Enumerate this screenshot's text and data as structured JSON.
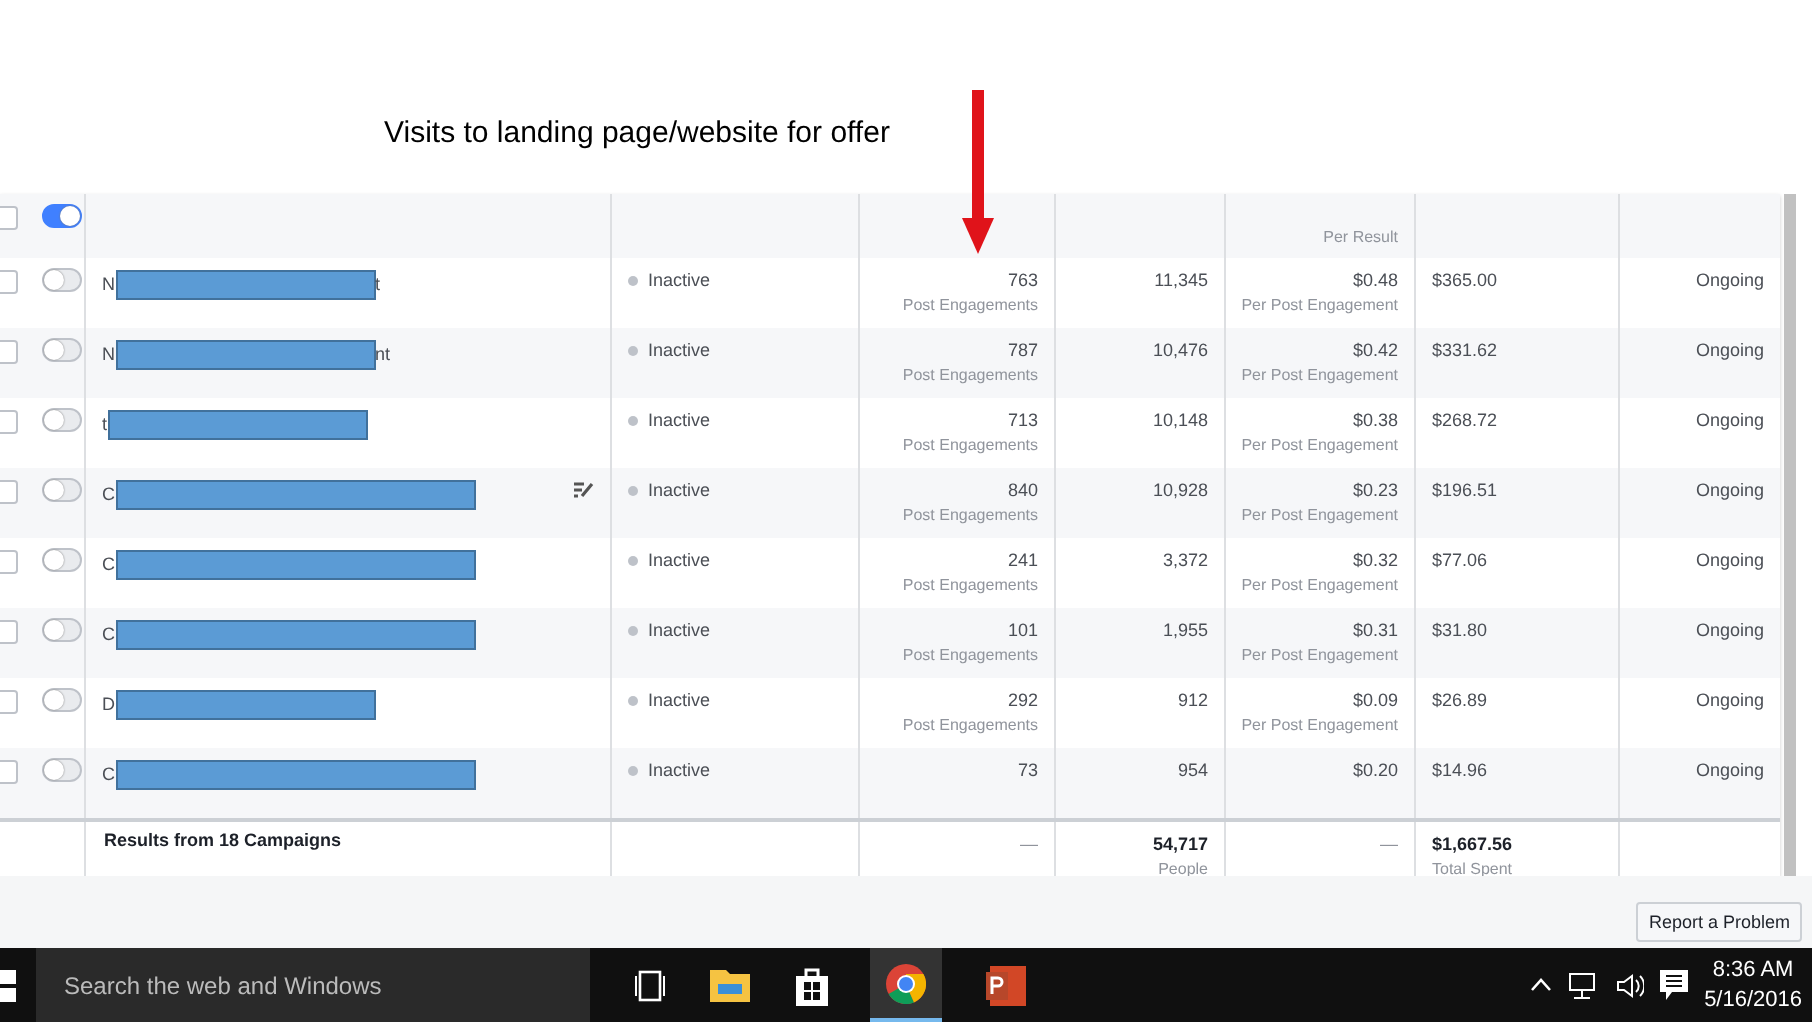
{
  "annotation": {
    "text": "Visits to landing page/website for offer"
  },
  "partial_row": {
    "checked": false,
    "toggle_on": true,
    "cost_label": "Per Result"
  },
  "rows": [
    {
      "name_start": "N",
      "name_end": "t",
      "status": "Inactive",
      "results": "763",
      "results_label": "Post Engagements",
      "reach": "11,345",
      "cost": "$0.48",
      "cost_label": "Per Post Engagement",
      "spent": "$365.00",
      "ends": "Ongoing",
      "checked": false,
      "toggle_on": false,
      "edit_icon": false
    },
    {
      "name_start": "N",
      "name_end": "nt",
      "status": "Inactive",
      "results": "787",
      "results_label": "Post Engagements",
      "reach": "10,476",
      "cost": "$0.42",
      "cost_label": "Per Post Engagement",
      "spent": "$331.62",
      "ends": "Ongoing",
      "checked": false,
      "toggle_on": false,
      "edit_icon": false
    },
    {
      "name_start": "t",
      "status": "Inactive",
      "results": "713",
      "results_label": "Post Engagements",
      "reach": "10,148",
      "cost": "$0.38",
      "cost_label": "Per Post Engagement",
      "spent": "$268.72",
      "ends": "Ongoing",
      "checked": false,
      "toggle_on": false,
      "edit_icon": false
    },
    {
      "name_start": "C",
      "status": "Inactive",
      "results": "840",
      "results_label": "Post Engagements",
      "reach": "10,928",
      "cost": "$0.23",
      "cost_label": "Per Post Engagement",
      "spent": "$196.51",
      "ends": "Ongoing",
      "checked": false,
      "toggle_on": false,
      "edit_icon": true
    },
    {
      "name_start": "C",
      "status": "Inactive",
      "results": "241",
      "results_label": "Post Engagements",
      "reach": "3,372",
      "cost": "$0.32",
      "cost_label": "Per Post Engagement",
      "spent": "$77.06",
      "ends": "Ongoing",
      "checked": false,
      "toggle_on": false,
      "edit_icon": false
    },
    {
      "name_start": "C",
      "status": "Inactive",
      "results": "101",
      "results_label": "Post Engagements",
      "reach": "1,955",
      "cost": "$0.31",
      "cost_label": "Per Post Engagement",
      "spent": "$31.80",
      "ends": "Ongoing",
      "checked": false,
      "toggle_on": false,
      "edit_icon": false
    },
    {
      "name_start": "D",
      "status": "Inactive",
      "results": "292",
      "results_label": "Post Engagements",
      "reach": "912",
      "cost": "$0.09",
      "cost_label": "Per Post Engagement",
      "spent": "$26.89",
      "ends": "Ongoing",
      "checked": false,
      "toggle_on": false,
      "edit_icon": false
    },
    {
      "name_start": "C",
      "status": "Inactive",
      "results": "73",
      "reach": "954",
      "cost": "$0.20",
      "spent": "$14.96",
      "ends": "Ongoing",
      "checked": false,
      "toggle_on": false,
      "edit_icon": false
    }
  ],
  "totals": {
    "label": "Results from 18 Campaigns",
    "results": "—",
    "reach": "54,717",
    "reach_label": "People",
    "cost": "—",
    "spent": "$1,667.56",
    "spent_label": "Total Spent"
  },
  "report_button": "Report a Problem",
  "taskbar": {
    "search_placeholder": "Search the web and Windows",
    "time": "8:36 AM",
    "date": "5/16/2016"
  }
}
